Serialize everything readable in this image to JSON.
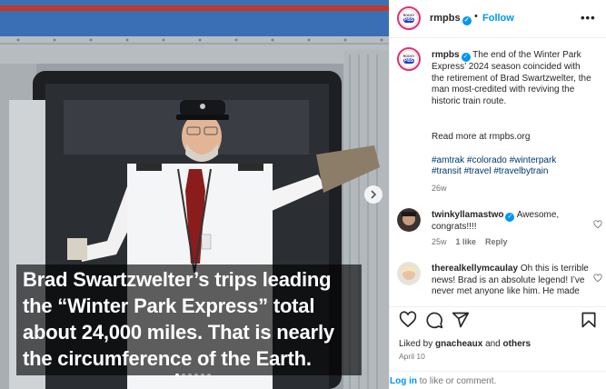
{
  "post": {
    "caption_lines": [
      "Brad Swartzwelter’s trips leading",
      "the “Winter Park Express” total",
      "about 24,000 miles. That is nearly",
      "the circumference of the Earth."
    ],
    "carousel_count": 6,
    "carousel_active": 0
  },
  "header": {
    "username": "rmpbs",
    "separator": "•",
    "follow_label": "Follow",
    "more_label": "•••"
  },
  "description": {
    "username": "rmpbs",
    "text": "The end of the Winter Park Express’ 2024 season coincided with the retirement of Brad Swartzwelter, the man most-credited with reviving the historic train route.",
    "read_more": "Read more at rmpbs.org",
    "hashtags_line1": "#amtrak #colorado #winterpark",
    "hashtags_line2": "#transit #travel #travelbytrain",
    "age": "26w"
  },
  "comments": [
    {
      "username": "twinkyllamastwo",
      "text": "Awesome, congrats!!!!",
      "age": "25w",
      "likes": "1 like",
      "reply": "Reply"
    },
    {
      "username": "therealkellymcaulay",
      "text": "Oh this is terrible news! Brad is an absolute legend! I’ve never met anyone like him. He made"
    }
  ],
  "footer": {
    "liked_prefix": "Liked by",
    "liked_user": "gnacheaux",
    "liked_and": "and",
    "liked_others": "others",
    "date": "April 10",
    "login_link": "Log in",
    "login_rest": "to like or comment."
  },
  "icons": {
    "verified": "verified-badge-icon",
    "heart": "heart-icon",
    "comment": "comment-icon",
    "share": "share-icon",
    "save": "bookmark-icon",
    "next": "chevron-right-icon"
  },
  "colors": {
    "link_blue": "#0095f6",
    "hashtag": "#00376b",
    "muted": "#737373"
  }
}
